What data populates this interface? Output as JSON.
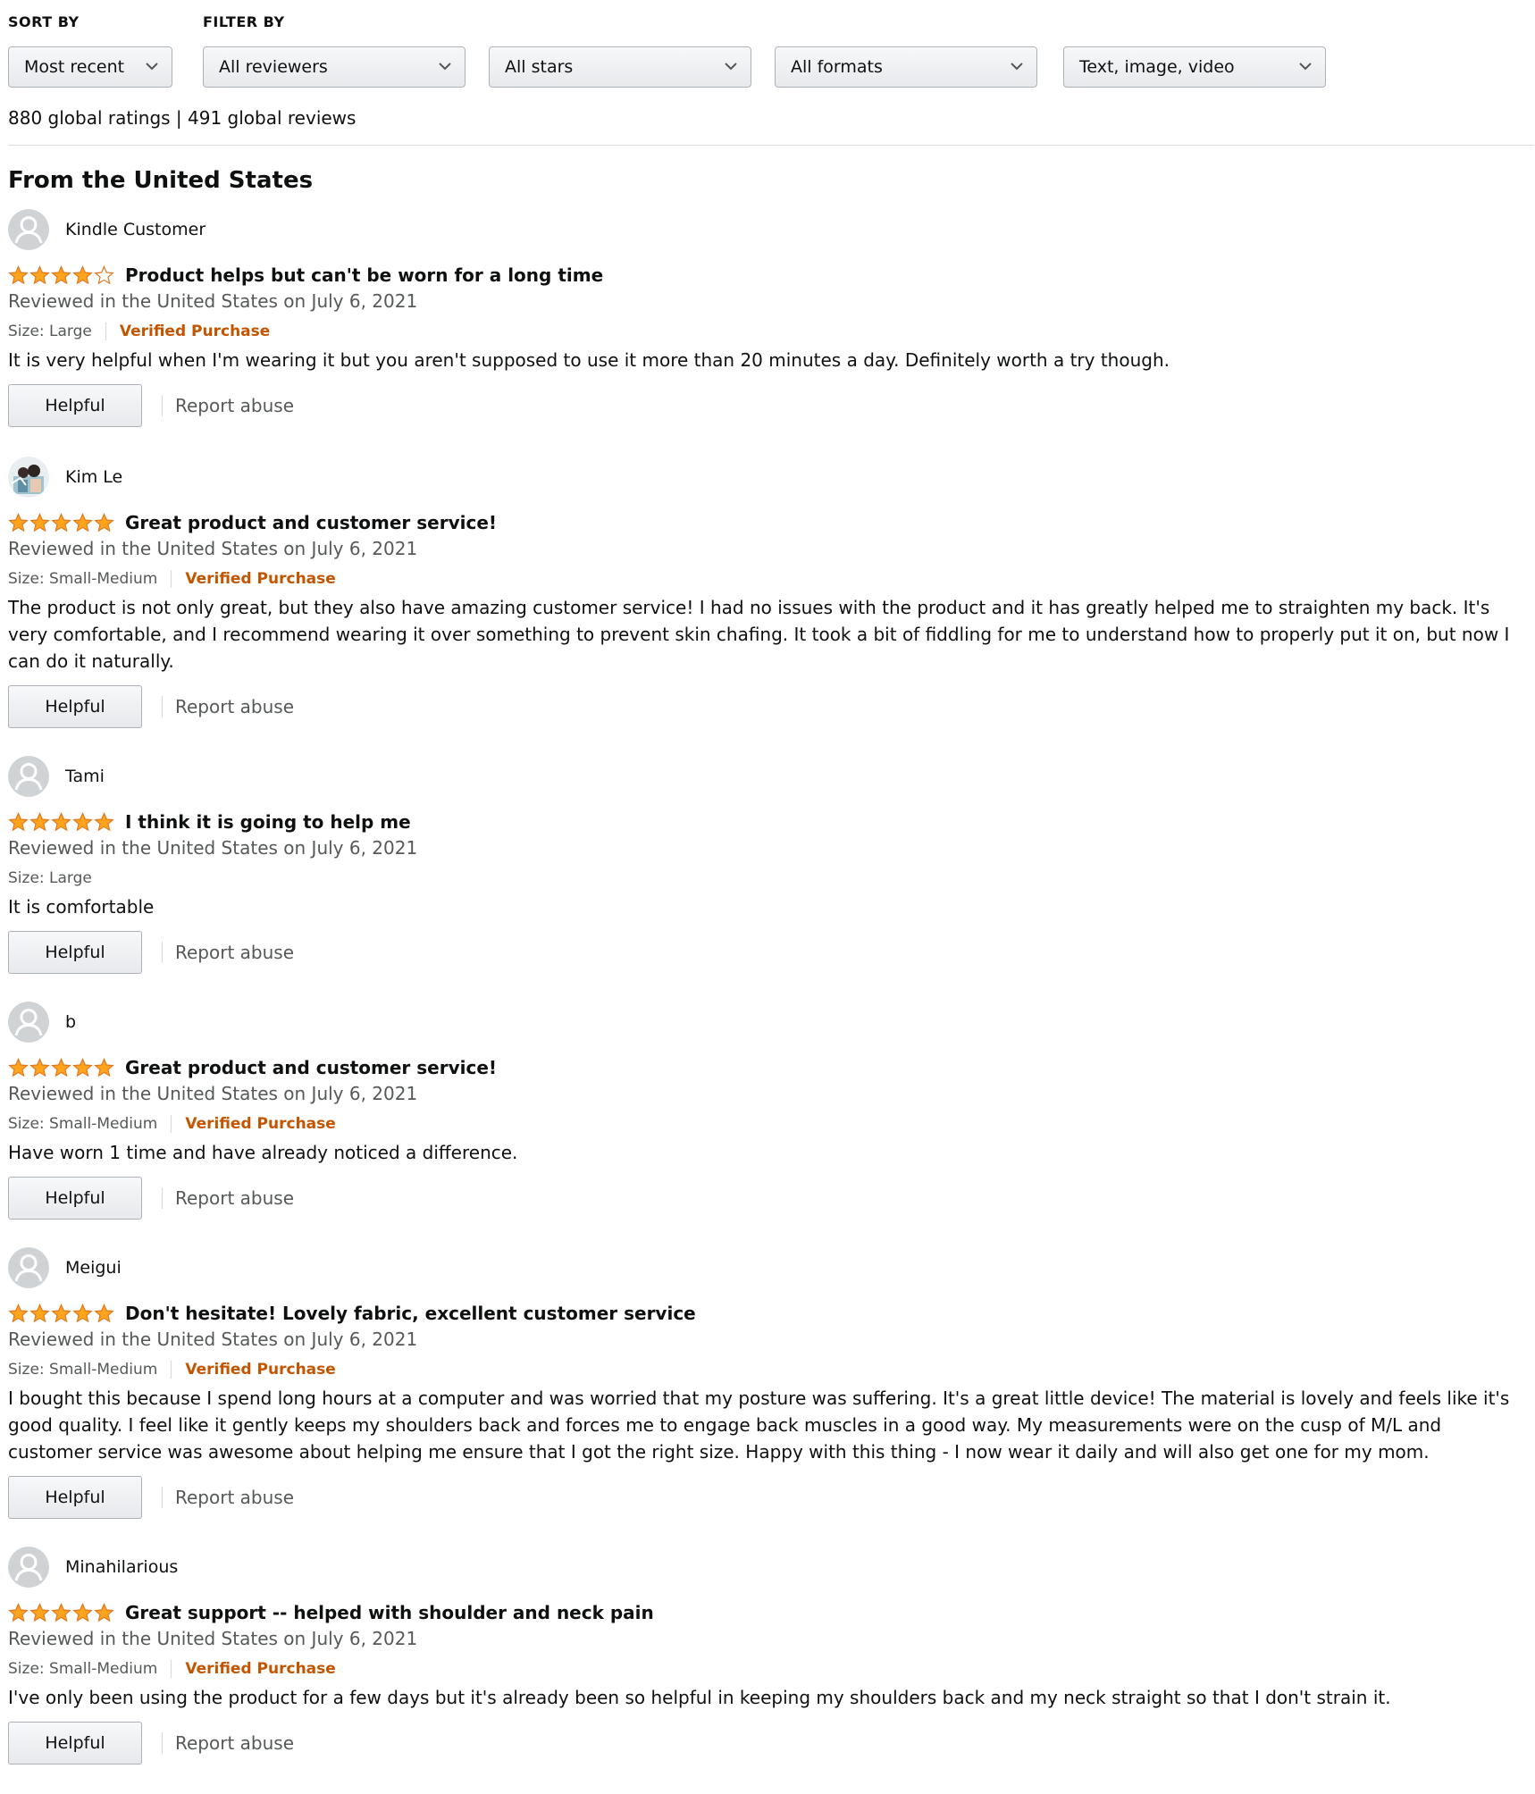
{
  "filters": {
    "sort_label": "SORT BY",
    "filter_label": "FILTER BY",
    "sort_value": "Most recent",
    "reviewers_value": "All reviewers",
    "stars_value": "All stars",
    "formats_value": "All formats",
    "media_value": "Text, image, video"
  },
  "summary": "880 global ratings | 491 global reviews",
  "region_title": "From the United States",
  "colors": {
    "star": "#ffa41c",
    "verified": "#c45500",
    "muted": "#565959"
  },
  "reviews": [
    {
      "author": "Kindle Customer",
      "avatar": "default-avatar-icon",
      "rating": 4,
      "title": "Product helps but can't be worn for a long time",
      "date": "Reviewed in the United States on July 6, 2021",
      "size": "Size: Large",
      "verified": "Verified Purchase",
      "body": "It is very helpful when I'm wearing it but you aren't supposed to use it more than 20 minutes a day. Definitely worth a try though.",
      "helpful": "Helpful",
      "report": "Report abuse"
    },
    {
      "author": "Kim Le",
      "avatar": "photo-avatar-icon",
      "rating": 5,
      "title": "Great product and customer service!",
      "date": "Reviewed in the United States on July 6, 2021",
      "size": "Size: Small-Medium",
      "verified": "Verified Purchase",
      "body": "The product is not only great, but they also have amazing customer service! I had no issues with the product and it has greatly helped me to straighten my back. It's very comfortable, and I recommend wearing it over something to prevent skin chafing. It took a bit of fiddling for me to understand how to properly put it on, but now I can do it naturally.",
      "helpful": "Helpful",
      "report": "Report abuse"
    },
    {
      "author": "Tami",
      "avatar": "default-avatar-icon",
      "rating": 5,
      "title": "I think it is going to help me",
      "date": "Reviewed in the United States on July 6, 2021",
      "size": "Size: Large",
      "verified": "",
      "body": "It is comfortable",
      "helpful": "Helpful",
      "report": "Report abuse"
    },
    {
      "author": "b",
      "avatar": "default-avatar-icon",
      "rating": 5,
      "title": "Great product and customer service!",
      "date": "Reviewed in the United States on July 6, 2021",
      "size": "Size: Small-Medium",
      "verified": "Verified Purchase",
      "body": "Have worn 1 time and have already noticed a difference.",
      "helpful": "Helpful",
      "report": "Report abuse"
    },
    {
      "author": "Meigui",
      "avatar": "default-avatar-icon",
      "rating": 5,
      "title": "Don't hesitate! Lovely fabric, excellent customer service",
      "date": "Reviewed in the United States on July 6, 2021",
      "size": "Size: Small-Medium",
      "verified": "Verified Purchase",
      "body": "I bought this because I spend long hours at a computer and was worried that my posture was suffering. It's a great little device! The material is lovely and feels like it's good quality. I feel like it gently keeps my shoulders back and forces me to engage back muscles in a good way. My measurements were on the cusp of M/L and customer service was awesome about helping me ensure that I got the right size. Happy with this thing - I now wear it daily and will also get one for my mom.",
      "helpful": "Helpful",
      "report": "Report abuse"
    },
    {
      "author": "Minahilarious",
      "avatar": "default-avatar-icon",
      "rating": 5,
      "title": "Great support -- helped with shoulder and neck pain",
      "date": "Reviewed in the United States on July 6, 2021",
      "size": "Size: Small-Medium",
      "verified": "Verified Purchase",
      "body": "I've only been using the product for a few days but it's already been so helpful in keeping my shoulders back and my neck straight so that I don't strain it.",
      "helpful": "Helpful",
      "report": "Report abuse"
    }
  ]
}
